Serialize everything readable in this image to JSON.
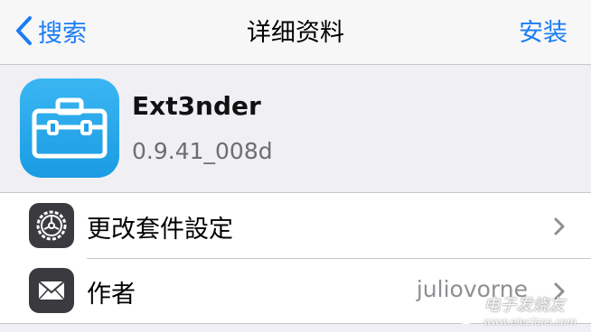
{
  "navbar": {
    "back_label": "搜索",
    "title": "详细资料",
    "install_label": "安装"
  },
  "package": {
    "icon": "toolbox-icon",
    "name": "Ext3nder",
    "version": "0.9.41_008d"
  },
  "rows": [
    {
      "icon": "gear-icon",
      "label": "更改套件設定",
      "detail": ""
    },
    {
      "icon": "mail-icon",
      "label": "作者",
      "detail": "juliovorne"
    }
  ],
  "watermark": {
    "text": "电子发烧友",
    "url": "www.elecfans.com"
  },
  "colors": {
    "accent": "#1a7cf5",
    "app_icon": "#1a9be3",
    "background": "#efeff4"
  }
}
